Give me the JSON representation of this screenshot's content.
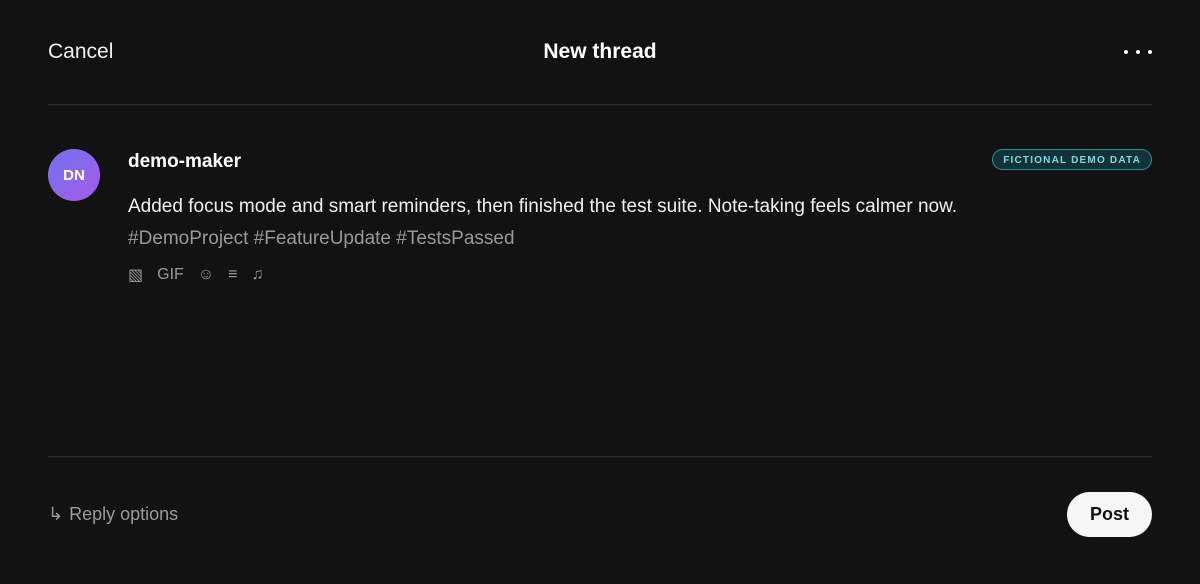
{
  "header": {
    "cancel_label": "Cancel",
    "title": "New thread",
    "more_icon": "more-horizontal-icon"
  },
  "composer": {
    "avatar_initials": "DN",
    "username": "demo-maker",
    "badge": "FICTIONAL DEMO DATA",
    "post_text": "Added focus mode and smart reminders, then finished the test suite. Note-taking feels calmer now.",
    "hashtags": "#DemoProject #FeatureUpdate #TestsPassed",
    "tools": {
      "image": "▧",
      "gif": "GIF",
      "emoji": "☺",
      "list": "≡",
      "music": "♫"
    }
  },
  "footer": {
    "reply_arrow": "↳",
    "reply_options_label": "Reply options",
    "post_label": "Post"
  },
  "colors": {
    "background": "#121212",
    "accent_badge": "#7fd7e5",
    "avatar_gradient_start": "#6f73f0",
    "avatar_gradient_end": "#a85ae6"
  }
}
